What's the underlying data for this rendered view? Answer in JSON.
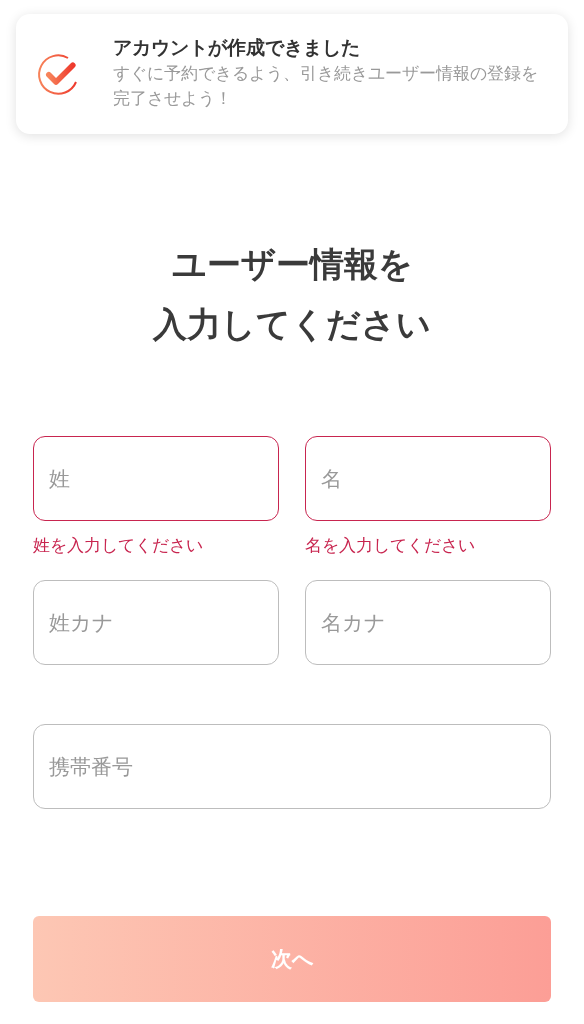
{
  "toast": {
    "title": "アカウントが作成できました",
    "message": "すぐに予約できるよう、引き続きユーザー情報の登録を完了させよう！"
  },
  "heading_lines": [
    "ユーザー情報を",
    "入力してください"
  ],
  "fields": [
    {
      "placeholder": "姓",
      "invalid": true,
      "error": "姓を入力してください"
    },
    {
      "placeholder": "名",
      "invalid": true,
      "error": "名を入力してください"
    },
    {
      "placeholder": "姓カナ",
      "invalid": false
    },
    {
      "placeholder": "名カナ",
      "invalid": false
    },
    {
      "placeholder": "携帯番号",
      "invalid": false
    }
  ],
  "next_button": {
    "label": "次へ",
    "disabled": true
  }
}
